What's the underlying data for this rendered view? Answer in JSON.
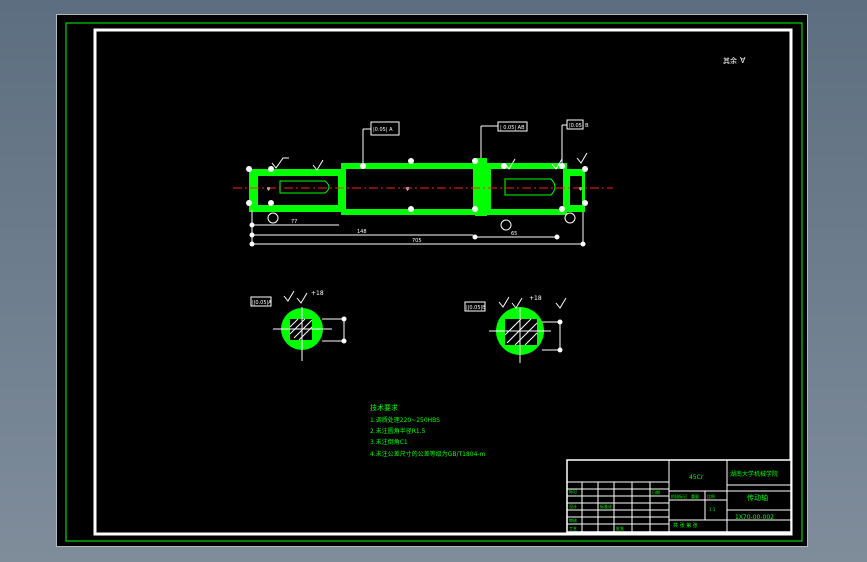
{
  "drawing": {
    "roughness_note": "其余",
    "dimensions": {
      "d1": "φ",
      "d2": "φ",
      "d3": "φ",
      "l1": "77",
      "l2": "148",
      "l3": "705",
      "l4": "65"
    },
    "tolerance_frames": {
      "left": "|0.05| A",
      "middle": "| 0.05| AB",
      "right": "|0.05| B"
    },
    "section_labels": {
      "left_frame": "||0.05|A",
      "left_dim": "+18",
      "right_frame": "||0.05|B",
      "right_dim": "+18"
    }
  },
  "notes": {
    "heading": "技术要求",
    "items": [
      "1.调质处理220~250HBS",
      "2.未注圆角半径R1.5",
      "3.未注倒角C1",
      "4.未注公差尺寸的公差等级为GB/T1804-m"
    ]
  },
  "title_block": {
    "material": "45Cr",
    "school": "湖南大学机械学院",
    "part_name": "传动轴",
    "drawing_no": "1X70-00-002",
    "scale_label": "比例",
    "scale_value": "1:1",
    "mark_label": "标记",
    "sheet_label": "共 张 第 张",
    "designer_label": "设计",
    "checker_label": "审核",
    "process_label": "工艺",
    "date_label": "日期",
    "standard_label": "标准化",
    "approve_label": "批准",
    "weight_label": "重量",
    "stage_label": "阶段标记"
  }
}
